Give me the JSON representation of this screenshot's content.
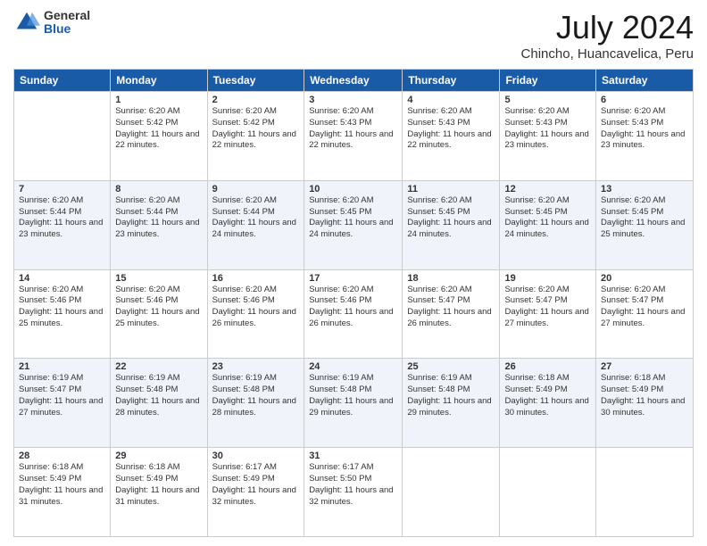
{
  "header": {
    "logo_general": "General",
    "logo_blue": "Blue",
    "month_title": "July 2024",
    "location": "Chincho, Huancavelica, Peru"
  },
  "calendar": {
    "headers": [
      "Sunday",
      "Monday",
      "Tuesday",
      "Wednesday",
      "Thursday",
      "Friday",
      "Saturday"
    ],
    "weeks": [
      [
        {
          "day": "",
          "sunrise": "",
          "sunset": "",
          "daylight": ""
        },
        {
          "day": "1",
          "sunrise": "Sunrise: 6:20 AM",
          "sunset": "Sunset: 5:42 PM",
          "daylight": "Daylight: 11 hours and 22 minutes."
        },
        {
          "day": "2",
          "sunrise": "Sunrise: 6:20 AM",
          "sunset": "Sunset: 5:42 PM",
          "daylight": "Daylight: 11 hours and 22 minutes."
        },
        {
          "day": "3",
          "sunrise": "Sunrise: 6:20 AM",
          "sunset": "Sunset: 5:43 PM",
          "daylight": "Daylight: 11 hours and 22 minutes."
        },
        {
          "day": "4",
          "sunrise": "Sunrise: 6:20 AM",
          "sunset": "Sunset: 5:43 PM",
          "daylight": "Daylight: 11 hours and 22 minutes."
        },
        {
          "day": "5",
          "sunrise": "Sunrise: 6:20 AM",
          "sunset": "Sunset: 5:43 PM",
          "daylight": "Daylight: 11 hours and 23 minutes."
        },
        {
          "day": "6",
          "sunrise": "Sunrise: 6:20 AM",
          "sunset": "Sunset: 5:43 PM",
          "daylight": "Daylight: 11 hours and 23 minutes."
        }
      ],
      [
        {
          "day": "7",
          "sunrise": "Sunrise: 6:20 AM",
          "sunset": "Sunset: 5:44 PM",
          "daylight": "Daylight: 11 hours and 23 minutes."
        },
        {
          "day": "8",
          "sunrise": "Sunrise: 6:20 AM",
          "sunset": "Sunset: 5:44 PM",
          "daylight": "Daylight: 11 hours and 23 minutes."
        },
        {
          "day": "9",
          "sunrise": "Sunrise: 6:20 AM",
          "sunset": "Sunset: 5:44 PM",
          "daylight": "Daylight: 11 hours and 24 minutes."
        },
        {
          "day": "10",
          "sunrise": "Sunrise: 6:20 AM",
          "sunset": "Sunset: 5:45 PM",
          "daylight": "Daylight: 11 hours and 24 minutes."
        },
        {
          "day": "11",
          "sunrise": "Sunrise: 6:20 AM",
          "sunset": "Sunset: 5:45 PM",
          "daylight": "Daylight: 11 hours and 24 minutes."
        },
        {
          "day": "12",
          "sunrise": "Sunrise: 6:20 AM",
          "sunset": "Sunset: 5:45 PM",
          "daylight": "Daylight: 11 hours and 24 minutes."
        },
        {
          "day": "13",
          "sunrise": "Sunrise: 6:20 AM",
          "sunset": "Sunset: 5:45 PM",
          "daylight": "Daylight: 11 hours and 25 minutes."
        }
      ],
      [
        {
          "day": "14",
          "sunrise": "Sunrise: 6:20 AM",
          "sunset": "Sunset: 5:46 PM",
          "daylight": "Daylight: 11 hours and 25 minutes."
        },
        {
          "day": "15",
          "sunrise": "Sunrise: 6:20 AM",
          "sunset": "Sunset: 5:46 PM",
          "daylight": "Daylight: 11 hours and 25 minutes."
        },
        {
          "day": "16",
          "sunrise": "Sunrise: 6:20 AM",
          "sunset": "Sunset: 5:46 PM",
          "daylight": "Daylight: 11 hours and 26 minutes."
        },
        {
          "day": "17",
          "sunrise": "Sunrise: 6:20 AM",
          "sunset": "Sunset: 5:46 PM",
          "daylight": "Daylight: 11 hours and 26 minutes."
        },
        {
          "day": "18",
          "sunrise": "Sunrise: 6:20 AM",
          "sunset": "Sunset: 5:47 PM",
          "daylight": "Daylight: 11 hours and 26 minutes."
        },
        {
          "day": "19",
          "sunrise": "Sunrise: 6:20 AM",
          "sunset": "Sunset: 5:47 PM",
          "daylight": "Daylight: 11 hours and 27 minutes."
        },
        {
          "day": "20",
          "sunrise": "Sunrise: 6:20 AM",
          "sunset": "Sunset: 5:47 PM",
          "daylight": "Daylight: 11 hours and 27 minutes."
        }
      ],
      [
        {
          "day": "21",
          "sunrise": "Sunrise: 6:19 AM",
          "sunset": "Sunset: 5:47 PM",
          "daylight": "Daylight: 11 hours and 27 minutes."
        },
        {
          "day": "22",
          "sunrise": "Sunrise: 6:19 AM",
          "sunset": "Sunset: 5:48 PM",
          "daylight": "Daylight: 11 hours and 28 minutes."
        },
        {
          "day": "23",
          "sunrise": "Sunrise: 6:19 AM",
          "sunset": "Sunset: 5:48 PM",
          "daylight": "Daylight: 11 hours and 28 minutes."
        },
        {
          "day": "24",
          "sunrise": "Sunrise: 6:19 AM",
          "sunset": "Sunset: 5:48 PM",
          "daylight": "Daylight: 11 hours and 29 minutes."
        },
        {
          "day": "25",
          "sunrise": "Sunrise: 6:19 AM",
          "sunset": "Sunset: 5:48 PM",
          "daylight": "Daylight: 11 hours and 29 minutes."
        },
        {
          "day": "26",
          "sunrise": "Sunrise: 6:18 AM",
          "sunset": "Sunset: 5:49 PM",
          "daylight": "Daylight: 11 hours and 30 minutes."
        },
        {
          "day": "27",
          "sunrise": "Sunrise: 6:18 AM",
          "sunset": "Sunset: 5:49 PM",
          "daylight": "Daylight: 11 hours and 30 minutes."
        }
      ],
      [
        {
          "day": "28",
          "sunrise": "Sunrise: 6:18 AM",
          "sunset": "Sunset: 5:49 PM",
          "daylight": "Daylight: 11 hours and 31 minutes."
        },
        {
          "day": "29",
          "sunrise": "Sunrise: 6:18 AM",
          "sunset": "Sunset: 5:49 PM",
          "daylight": "Daylight: 11 hours and 31 minutes."
        },
        {
          "day": "30",
          "sunrise": "Sunrise: 6:17 AM",
          "sunset": "Sunset: 5:49 PM",
          "daylight": "Daylight: 11 hours and 32 minutes."
        },
        {
          "day": "31",
          "sunrise": "Sunrise: 6:17 AM",
          "sunset": "Sunset: 5:50 PM",
          "daylight": "Daylight: 11 hours and 32 minutes."
        },
        {
          "day": "",
          "sunrise": "",
          "sunset": "",
          "daylight": ""
        },
        {
          "day": "",
          "sunrise": "",
          "sunset": "",
          "daylight": ""
        },
        {
          "day": "",
          "sunrise": "",
          "sunset": "",
          "daylight": ""
        }
      ]
    ]
  }
}
